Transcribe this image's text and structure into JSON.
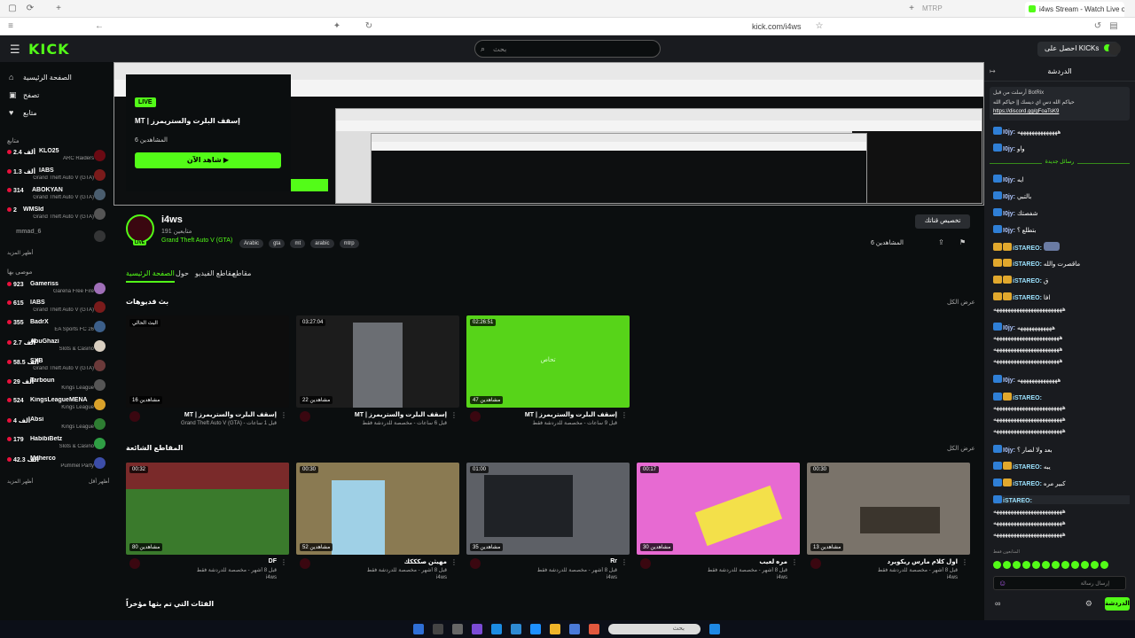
{
  "browser": {
    "tab_title": "i4ws Stream - Watch Live on Kick",
    "other_tab": "MTRP",
    "url": "kick.com/i4ws"
  },
  "header": {
    "logo": "KICK",
    "search_placeholder": "بحث",
    "get_kicks": "احصل على KICKs"
  },
  "sidebar": {
    "nav": [
      {
        "label": "الصفحة الرئيسية",
        "icon": "home-icon"
      },
      {
        "label": "تصفح",
        "icon": "browse-icon"
      },
      {
        "label": "متابع",
        "icon": "heart-icon"
      }
    ],
    "following_title": "متابع",
    "following": [
      {
        "viewers": "2.4 ألف",
        "name": "KLO25",
        "game": "ARC Raiders"
      },
      {
        "viewers": "1.3 ألف",
        "name": "IABS",
        "game": "Grand Theft Auto V (GTA)"
      },
      {
        "viewers": "314",
        "name": "ABOKYAN",
        "game": "Grand Theft Auto V (GTA)"
      },
      {
        "viewers": "2",
        "name": "WMSId",
        "game": "Grand Theft Auto V (GTA)"
      },
      {
        "viewers": "",
        "name": "mmad_6",
        "game": ""
      }
    ],
    "show_more_1": "أظهر المزيد",
    "recommended_title": "موصى بها",
    "recommended": [
      {
        "viewers": "923",
        "name": "Gameriss",
        "game": "Garena Free Fire"
      },
      {
        "viewers": "615",
        "name": "IABS",
        "game": "Grand Theft Auto V (GTA)"
      },
      {
        "viewers": "355",
        "name": "BadrX",
        "game": "EA Sports FC 26"
      },
      {
        "viewers": "2.7 ألف",
        "name": "AbuGhazi",
        "game": "Slots & Casino"
      },
      {
        "viewers": "58.5 ألف",
        "name": "SXB",
        "game": "Grand Theft Auto V (GTA)"
      },
      {
        "viewers": "29 ألف",
        "name": "Tarboun",
        "game": "Kings League"
      },
      {
        "viewers": "524",
        "name": "KingsLeagueMENA",
        "game": "Kings League"
      },
      {
        "viewers": "4 ألف",
        "name": "Absi",
        "game": "Kings League"
      },
      {
        "viewers": "179",
        "name": "HabibiBetz",
        "game": "Slots & Casino"
      },
      {
        "viewers": "42.3 ألف",
        "name": "Maherco",
        "game": "Pummel Party"
      }
    ],
    "show_more_2": "أظهر المزيد",
    "show_less": "أظهر أقل"
  },
  "player": {
    "live_badge": "LIVE",
    "title": "MT | إسقف البلرت والستريمرز",
    "viewers": "6 المشاهدين",
    "watch_now": "شاهد الآن ▶"
  },
  "channel": {
    "name": "i4ws",
    "followers": "191 متابعين",
    "game": "Grand Theft Auto V (GTA)",
    "tags": [
      "Arabic",
      "gta",
      "mt",
      "arabic",
      "mtrp"
    ],
    "customize": "تخصيص قناتك",
    "viewers": "6 المشاهدين",
    "tabs": [
      "الصفحة الرئيسية",
      "حول",
      "مقاطع الفيديو",
      "مقاطع"
    ]
  },
  "past_broadcasts": {
    "title": "بث قديوهات",
    "see_all": "عرض الكل",
    "items": [
      {
        "duration": "البث الحالي",
        "views": "16 مشاهدين",
        "title": "MT | إسقف البلرت والستريمرز",
        "sub": "Grand Theft Auto V (GTA) - قبل 1 ساعات",
        "bg": "#0d0d0d"
      },
      {
        "duration": "03:27:04",
        "views": "22 مشاهدين",
        "title": "MT | إسقف البلرت والستريمرز",
        "sub": "قبل 6 ساعات - مخصصة للدردشة فقط",
        "bg": "#1c1c1c"
      },
      {
        "duration": "02:26:51",
        "views": "47 مشاهدين",
        "title": "MT | إسقف البلرت والستريمرز",
        "sub": "قبل 9 ساعات - مخصصة للدردشة فقط",
        "bg": "#57d419",
        "center": "تحاص"
      }
    ]
  },
  "popular_clips": {
    "title": "المقاطع الشائعة",
    "see_all": "عرض الكل",
    "items": [
      {
        "duration": "00:32",
        "views": "80 مشاهدين",
        "title": "DF",
        "sub": "قبل 8 أشهر - مخصصة للدردشة فقط",
        "user": "i4ws",
        "bg": "#3a7a2c"
      },
      {
        "duration": "00:30",
        "views": "52 مشاهدين",
        "title": "مهيثن صكككك",
        "sub": "قبل 8 أشهر - مخصصة للدردشة فقط",
        "user": "i4ws",
        "bg": "#8a7a52"
      },
      {
        "duration": "01:00",
        "views": "35 مشاهدين",
        "title": "Rr",
        "sub": "قبل 8 أشهر - مخصصة للدردشة فقط",
        "user": "i4ws",
        "bg": "#5d6066"
      },
      {
        "duration": "00:17",
        "views": "30 مشاهدين",
        "title": "مره لعيب",
        "sub": "قبل 8 أشهر - مخصصة للدردشة فقط",
        "user": "i4ws",
        "bg": "#e76ad2"
      },
      {
        "duration": "00:30",
        "views": "13 مشاهدين",
        "title": "اول كلام مارس ريكويرد",
        "sub": "قبل 8 أشهر - مخصصة للدردشة فقط",
        "user": "i4ws",
        "bg": "#7a736a"
      }
    ]
  },
  "recent_categories": "الفئات التي تم بثها مؤخراً",
  "chat": {
    "title": "الدردشة",
    "pinned_by": "أرسلت من قبل BotRix",
    "pinned_text": "حياكم الله دس اي ديسك || حياكم الله",
    "pinned_link": "https://discord.gg/gFoaTsK9",
    "new_messages": "رسائل جديدة",
    "messages": [
      {
        "user": "I0jy:",
        "text": "ههههههههههههههه",
        "gold": false
      },
      {
        "user": "I0jy:",
        "text": "واو",
        "gold": false
      },
      {
        "user": "I0jy:",
        "text": "ايه",
        "gold": false
      },
      {
        "user": "I0jy:",
        "text": "بالتبي",
        "gold": false
      },
      {
        "user": "I0jy:",
        "text": "شفصتك",
        "gold": false
      },
      {
        "user": "I0jy:",
        "text": "بتطلع ؟",
        "gold": false
      },
      {
        "user": "iSTAREO:",
        "text": "",
        "gold": true
      },
      {
        "user": "iSTAREO:",
        "text": "ماقصرت والله",
        "gold": true
      },
      {
        "user": "iSTAREO:",
        "text": "ق",
        "gold": true
      },
      {
        "user": "iSTAREO:",
        "text": "افا",
        "gold": true
      }
    ],
    "spam_1": "ههههههههههههههههههههههههه",
    "msg_b1": {
      "user": "I0jy:",
      "text": "ههههههههههههه"
    },
    "spam_2": "هههههههههههههههههههههههه",
    "msg_b2": {
      "user": "I0jy:",
      "text": "ههههههههههههههه"
    },
    "msg_b3": {
      "user": "iSTAREO:",
      "text": ""
    },
    "spam_3": "ههههههههههههههههههههههههه",
    "msg_c1": {
      "user": "I0jy:",
      "text": "بعد ولا لصار ؟"
    },
    "msg_c2": {
      "user": "iSTAREO:",
      "text": "يبه"
    },
    "msg_c3": {
      "user": "iSTAREO:",
      "text": "كبير مره"
    },
    "msg_c4": {
      "user": "iSTAREO:",
      "text": ""
    },
    "spam_4": "ههههههههههههههههههههههههه",
    "followers_only": "المتابعون فقط",
    "input_placeholder": "إرسال رسالة",
    "send_button": "الدردشة"
  },
  "taskbar": {
    "search": "بحث"
  }
}
